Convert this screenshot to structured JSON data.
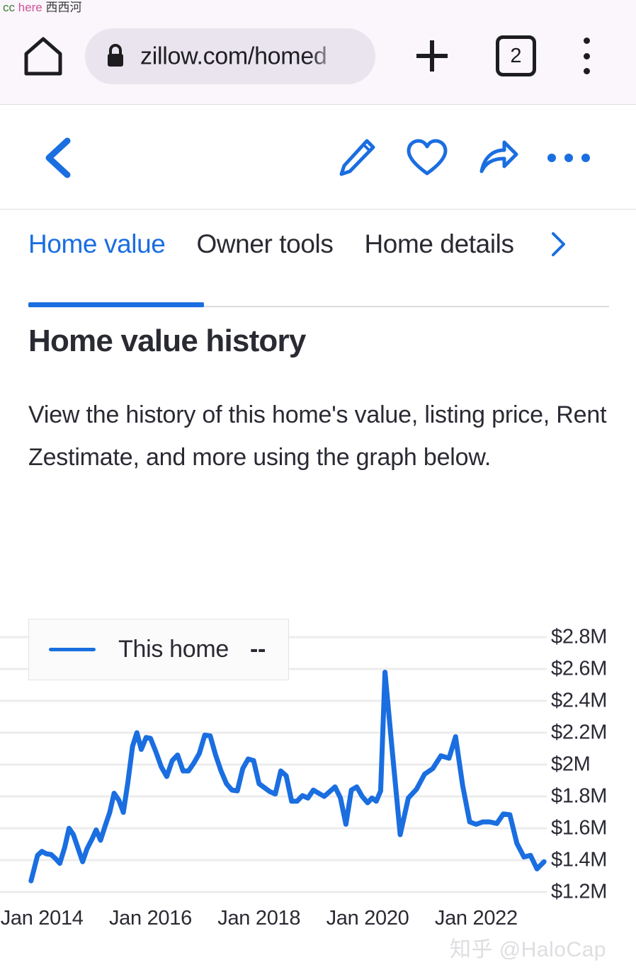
{
  "watermarks": {
    "top": {
      "part1": "cc",
      "part2": "here",
      "part3": "西西河"
    },
    "bottom": "知乎 @HaloCap"
  },
  "browser": {
    "home_icon": "home-icon",
    "lock_icon": "lock-icon",
    "url": "zillow.com/homed",
    "new_tab_icon": "plus-icon",
    "tab_count": "2",
    "menu_icon": "kebab-menu-icon"
  },
  "app_toolbar": {
    "back_icon": "chevron-left-icon",
    "edit_icon": "pencil-icon",
    "favorite_icon": "heart-icon",
    "share_icon": "share-arrow-icon",
    "more_icon": "ellipsis-icon"
  },
  "tabs": {
    "items": [
      {
        "label": "Home value",
        "active": true
      },
      {
        "label": "Owner tools",
        "active": false
      },
      {
        "label": "Home details",
        "active": false
      }
    ],
    "overflow_icon": "chevron-right-icon"
  },
  "section": {
    "title": "Home value history",
    "body": "View the history of this home's value, listing price, Rent Zestimate, and more using the graph below."
  },
  "legend": {
    "series_label": "This home",
    "value": "--",
    "color": "#1a6ee0"
  },
  "colors": {
    "accent": "#1a6ee0",
    "text": "#2a2a33",
    "gridline": "#ececec",
    "omnibox_bg": "#e9e4ee",
    "browser_bg": "#faf6fb"
  },
  "chart_data": {
    "type": "line",
    "title": "Home value history",
    "xlabel": "",
    "ylabel": "",
    "grid": true,
    "legend_position": "top-left",
    "ylim": [
      1200000,
      2800000
    ],
    "ytick_labels": [
      "$2.8M",
      "$2.6M",
      "$2.4M",
      "$2.2M",
      "$2M",
      "$1.8M",
      "$1.6M",
      "$1.4M",
      "$1.2M"
    ],
    "ytick_values": [
      2800000,
      2600000,
      2400000,
      2200000,
      2000000,
      1800000,
      1600000,
      1400000,
      1200000
    ],
    "xtick_labels": [
      "Jan 2014",
      "Jan 2016",
      "Jan 2018",
      "Jan 2020",
      "Jan 2022"
    ],
    "xtick_values": [
      2014.0,
      2016.0,
      2018.0,
      2020.0,
      2022.0
    ],
    "xlim": [
      2013.75,
      2023.3
    ],
    "series": [
      {
        "name": "This home",
        "color": "#1a6ee0",
        "x": [
          2013.8,
          2013.92,
          2014.0,
          2014.08,
          2014.17,
          2014.25,
          2014.33,
          2014.42,
          2014.5,
          2014.58,
          2014.67,
          2014.75,
          2014.83,
          2014.92,
          2015.0,
          2015.08,
          2015.17,
          2015.25,
          2015.33,
          2015.42,
          2015.5,
          2015.58,
          2015.67,
          2015.75,
          2015.83,
          2015.92,
          2016.0,
          2016.1,
          2016.2,
          2016.3,
          2016.4,
          2016.5,
          2016.6,
          2016.7,
          2016.8,
          2016.9,
          2017.0,
          2017.1,
          2017.2,
          2017.3,
          2017.4,
          2017.5,
          2017.6,
          2017.7,
          2017.8,
          2017.9,
          2018.0,
          2018.1,
          2018.2,
          2018.3,
          2018.4,
          2018.5,
          2018.6,
          2018.7,
          2018.8,
          2018.9,
          2019.0,
          2019.1,
          2019.2,
          2019.3,
          2019.4,
          2019.5,
          2019.6,
          2019.7,
          2019.8,
          2019.9,
          2020.0,
          2020.08,
          2020.16,
          2020.24,
          2020.32,
          2020.45,
          2020.6,
          2020.75,
          2020.9,
          2021.05,
          2021.2,
          2021.35,
          2021.5,
          2021.62,
          2021.75,
          2021.88,
          2022.0,
          2022.12,
          2022.25,
          2022.38,
          2022.5,
          2022.62,
          2022.75,
          2022.88,
          2023.0,
          2023.12,
          2023.25
        ],
        "y": [
          1270000,
          1430000,
          1455000,
          1440000,
          1435000,
          1410000,
          1380000,
          1480000,
          1600000,
          1560000,
          1470000,
          1390000,
          1470000,
          1530000,
          1590000,
          1525000,
          1620000,
          1700000,
          1820000,
          1775000,
          1700000,
          1880000,
          2115000,
          2200000,
          2095000,
          2170000,
          2165000,
          2080000,
          1985000,
          1925000,
          2025000,
          2060000,
          1960000,
          1960000,
          2010000,
          2070000,
          2185000,
          2180000,
          2060000,
          1960000,
          1880000,
          1840000,
          1835000,
          1975000,
          2035000,
          2025000,
          1880000,
          1855000,
          1830000,
          1815000,
          1960000,
          1930000,
          1770000,
          1770000,
          1805000,
          1790000,
          1840000,
          1820000,
          1800000,
          1830000,
          1860000,
          1790000,
          1625000,
          1840000,
          1860000,
          1800000,
          1760000,
          1790000,
          1770000,
          1835000,
          2580000,
          2100000,
          1560000,
          1790000,
          1845000,
          1940000,
          1975000,
          2055000,
          2040000,
          2175000,
          1870000,
          1640000,
          1625000,
          1640000,
          1640000,
          1630000,
          1690000,
          1685000,
          1505000,
          1420000,
          1430000,
          1345000,
          1390000
        ]
      }
    ]
  }
}
